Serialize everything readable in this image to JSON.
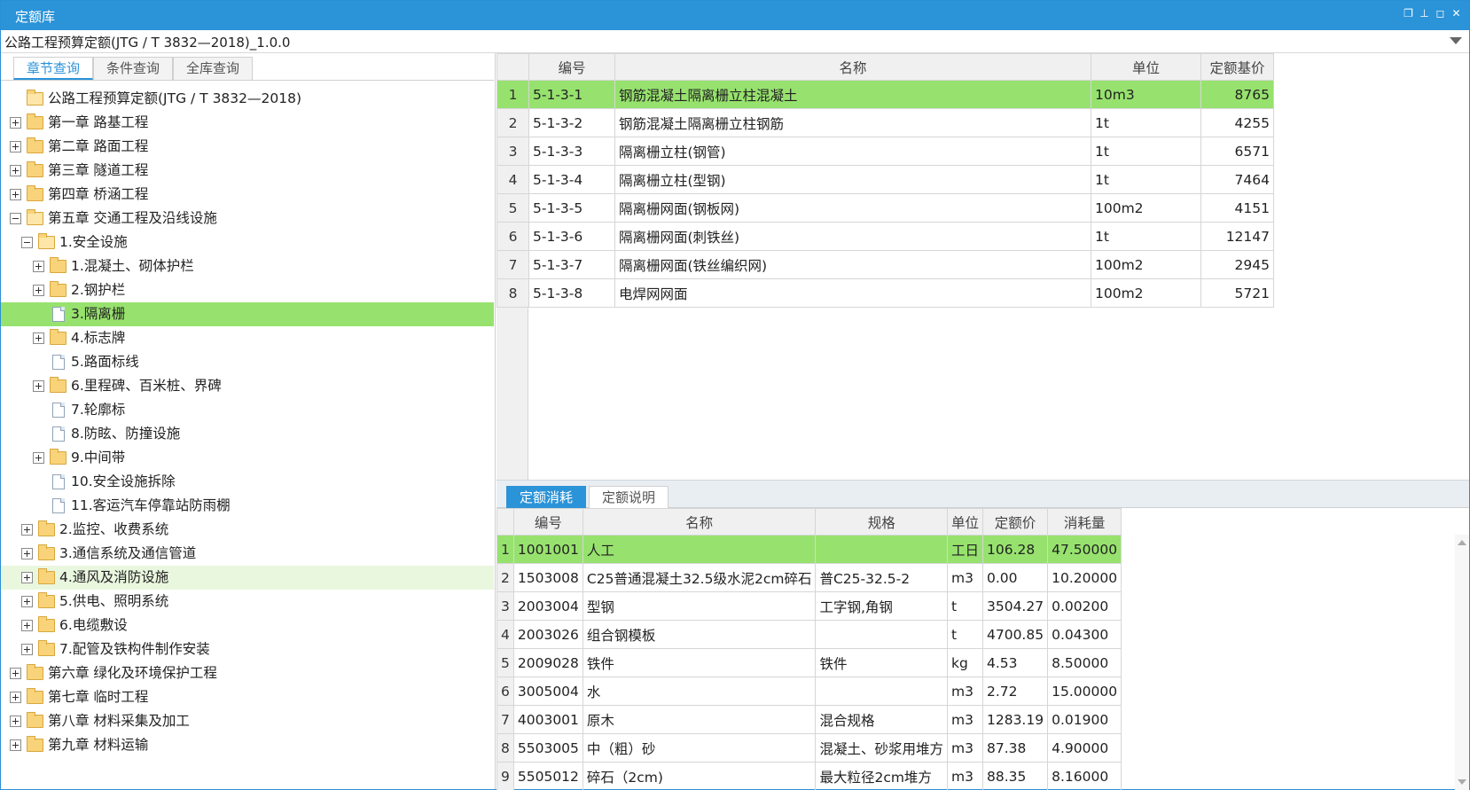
{
  "window": {
    "title": "定额库"
  },
  "library_select": {
    "value": "公路工程预算定额(JTG / T 3832—2018)_1.0.0"
  },
  "left_tabs": [
    "章节查询",
    "条件查询",
    "全库查询"
  ],
  "tree": [
    {
      "label": "公路工程预算定额(JTG / T 3832—2018)",
      "level": 0,
      "type": "folder-open",
      "exp": ""
    },
    {
      "label": "第一章 路基工程",
      "level": 0,
      "type": "folder",
      "exp": "plus"
    },
    {
      "label": "第二章 路面工程",
      "level": 0,
      "type": "folder",
      "exp": "plus"
    },
    {
      "label": "第三章 隧道工程",
      "level": 0,
      "type": "folder",
      "exp": "plus"
    },
    {
      "label": "第四章 桥涵工程",
      "level": 0,
      "type": "folder",
      "exp": "plus"
    },
    {
      "label": "第五章 交通工程及沿线设施",
      "level": 0,
      "type": "folder-open",
      "exp": "minus"
    },
    {
      "label": "1.安全设施",
      "level": 1,
      "type": "folder-open",
      "exp": "minus"
    },
    {
      "label": "1.混凝土、砌体护栏",
      "level": 2,
      "type": "folder",
      "exp": "plus"
    },
    {
      "label": "2.钢护栏",
      "level": 2,
      "type": "folder",
      "exp": "plus"
    },
    {
      "label": "3.隔离栅",
      "level": 2,
      "type": "doc",
      "exp": "",
      "selected": true
    },
    {
      "label": "4.标志牌",
      "level": 2,
      "type": "folder",
      "exp": "plus"
    },
    {
      "label": "5.路面标线",
      "level": 2,
      "type": "doc",
      "exp": ""
    },
    {
      "label": "6.里程碑、百米桩、界碑",
      "level": 2,
      "type": "folder",
      "exp": "plus"
    },
    {
      "label": "7.轮廓标",
      "level": 2,
      "type": "doc",
      "exp": ""
    },
    {
      "label": "8.防眩、防撞设施",
      "level": 2,
      "type": "doc",
      "exp": ""
    },
    {
      "label": "9.中间带",
      "level": 2,
      "type": "folder",
      "exp": "plus"
    },
    {
      "label": "10.安全设施拆除",
      "level": 2,
      "type": "doc",
      "exp": ""
    },
    {
      "label": "11.客运汽车停靠站防雨棚",
      "level": 2,
      "type": "doc",
      "exp": ""
    },
    {
      "label": "2.监控、收费系统",
      "level": 1,
      "type": "folder",
      "exp": "plus"
    },
    {
      "label": "3.通信系统及通信管道",
      "level": 1,
      "type": "folder",
      "exp": "plus"
    },
    {
      "label": "4.通风及消防设施",
      "level": 1,
      "type": "folder",
      "exp": "plus",
      "hover": true
    },
    {
      "label": "5.供电、照明系统",
      "level": 1,
      "type": "folder",
      "exp": "plus"
    },
    {
      "label": "6.电缆敷设",
      "level": 1,
      "type": "folder",
      "exp": "plus"
    },
    {
      "label": "7.配管及铁构件制作安装",
      "level": 1,
      "type": "folder",
      "exp": "plus"
    },
    {
      "label": "第六章 绿化及环境保护工程",
      "level": 0,
      "type": "folder",
      "exp": "plus"
    },
    {
      "label": "第七章 临时工程",
      "level": 0,
      "type": "folder",
      "exp": "plus"
    },
    {
      "label": "第八章 材料采集及加工",
      "level": 0,
      "type": "folder",
      "exp": "plus"
    },
    {
      "label": "第九章 材料运输",
      "level": 0,
      "type": "folder",
      "exp": "plus"
    }
  ],
  "quota_table": {
    "headers": [
      "",
      "编号",
      "名称",
      "单位",
      "定额基价"
    ],
    "rows": [
      [
        "1",
        "5-1-3-1",
        "钢筋混凝土隔离栅立柱混凝土",
        "10m3",
        "8765"
      ],
      [
        "2",
        "5-1-3-2",
        "钢筋混凝土隔离栅立柱钢筋",
        "1t",
        "4255"
      ],
      [
        "3",
        "5-1-3-3",
        "隔离栅立柱(钢管)",
        "1t",
        "6571"
      ],
      [
        "4",
        "5-1-3-4",
        "隔离栅立柱(型钢)",
        "1t",
        "7464"
      ],
      [
        "5",
        "5-1-3-5",
        "隔离栅网面(钢板网)",
        "100m2",
        "4151"
      ],
      [
        "6",
        "5-1-3-6",
        "隔离栅网面(刺铁丝)",
        "1t",
        "12147"
      ],
      [
        "7",
        "5-1-3-7",
        "隔离栅网面(铁丝编织网)",
        "100m2",
        "2945"
      ],
      [
        "8",
        "5-1-3-8",
        "电焊网网面",
        "100m2",
        "5721"
      ]
    ]
  },
  "bottom_tabs": [
    "定额消耗",
    "定额说明"
  ],
  "consumption_table": {
    "headers": [
      "",
      "编号",
      "名称",
      "规格",
      "单位",
      "定额价",
      "消耗量"
    ],
    "rows": [
      [
        "1",
        "1001001",
        "人工",
        "",
        "工日",
        "106.28",
        "47.50000"
      ],
      [
        "2",
        "1503008",
        "C25普通混凝土32.5级水泥2cm碎石",
        "普C25-32.5-2",
        "m3",
        "0.00",
        "10.20000"
      ],
      [
        "3",
        "2003004",
        "型钢",
        "工字钢,角钢",
        "t",
        "3504.27",
        "0.00200"
      ],
      [
        "4",
        "2003026",
        "组合钢模板",
        "",
        "t",
        "4700.85",
        "0.04300"
      ],
      [
        "5",
        "2009028",
        "铁件",
        "铁件",
        "kg",
        "4.53",
        "8.50000"
      ],
      [
        "6",
        "3005004",
        "水",
        "",
        "m3",
        "2.72",
        "15.00000"
      ],
      [
        "7",
        "4003001",
        "原木",
        "混合规格",
        "m3",
        "1283.19",
        "0.01900"
      ],
      [
        "8",
        "5503005",
        "中（粗）砂",
        "混凝土、砂浆用堆方",
        "m3",
        "87.38",
        "4.90000"
      ],
      [
        "9",
        "5505012",
        "碎石（2cm)",
        "最大粒径2cm堆方",
        "m3",
        "88.35",
        "8.16000"
      ]
    ]
  },
  "colors": {
    "accent": "#2b93d8",
    "selected_row": "#97e26e"
  },
  "icons": [
    "restore-icon",
    "pin-icon",
    "maximize-icon",
    "close-icon",
    "dropdown-arrow-icon",
    "folder-icon",
    "document-icon"
  ]
}
